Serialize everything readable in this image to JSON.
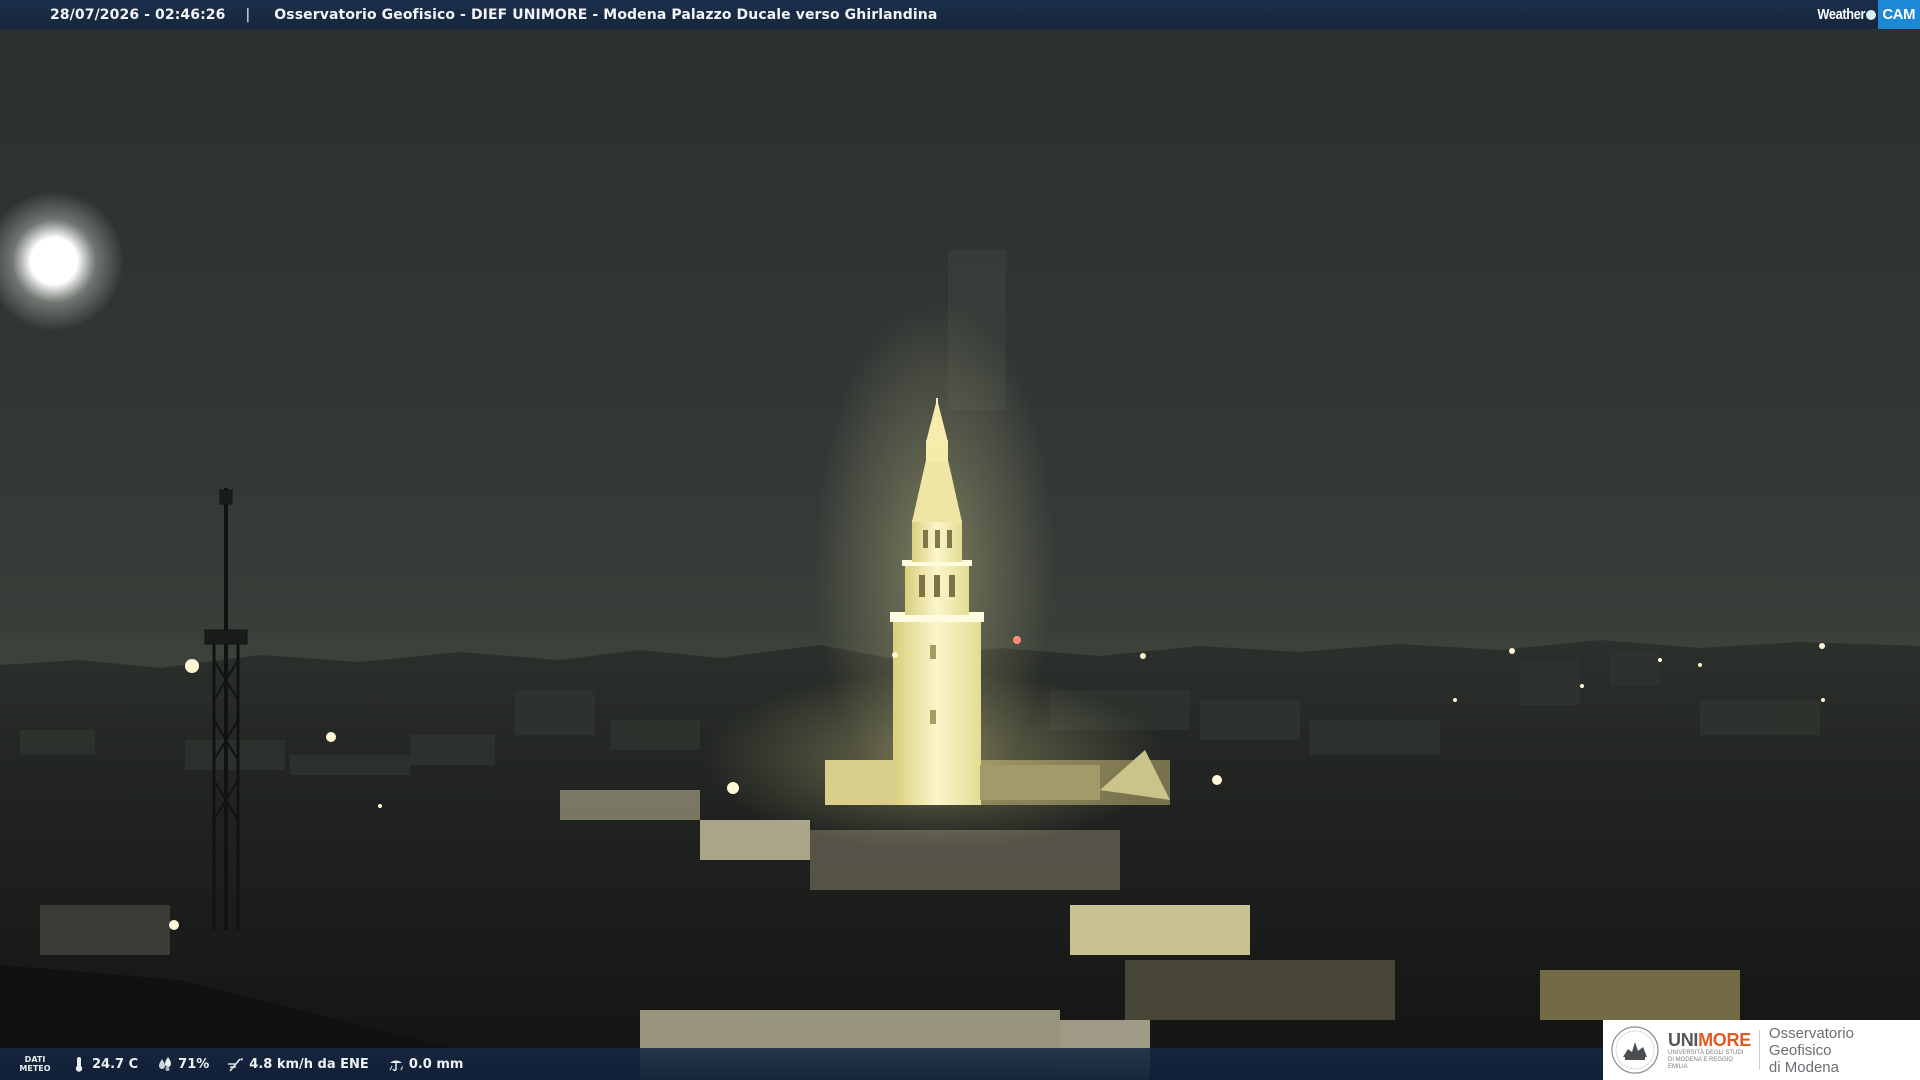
{
  "top_bar": {
    "timestamp": "28/07/2026 - 02:46:26",
    "separator": "|",
    "title": "Osservatorio Geofisico - DIEF UNIMORE - Modena Palazzo Ducale verso Ghirlandina"
  },
  "brand": {
    "weather": "Weather",
    "cam": "CAM"
  },
  "weather_bar": {
    "label_line1": "DATI",
    "label_line2": "METEO",
    "temperature": "24.7 C",
    "humidity": "71%",
    "wind": "4.8 km/h da ENE",
    "rain": "0.0 mm"
  },
  "logo": {
    "uni": "UNI",
    "more": "MORE",
    "subtitle": "UNIVERSITÀ DEGLI STUDI DI MODENA E REGGIO EMILIA",
    "obs_line1": "Osservatorio Geofisico",
    "obs_line2": "di Modena"
  },
  "icons": {
    "temperature": "thermometer-icon",
    "humidity": "droplets-icon",
    "wind": "wind-icon",
    "rain": "rain-gauge-icon"
  },
  "colors": {
    "bar_blue": "#1b2e4a",
    "cam_blue": "#1c88d6",
    "unimore_orange": "#e35a22",
    "sky": "#353a38",
    "tower_light": "#f4eca8"
  }
}
